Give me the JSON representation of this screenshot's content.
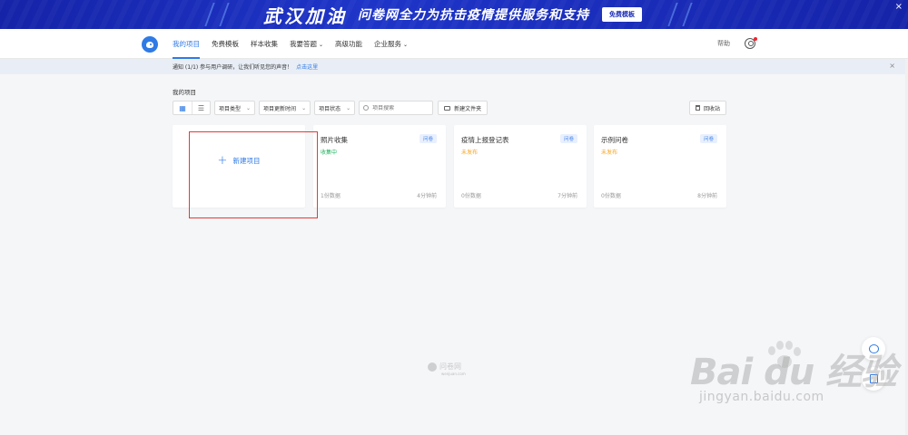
{
  "banner": {
    "slogan_left": "武汉加油",
    "slogan_right": "问卷网全力为抗击疫情提供服务和支持",
    "button_label": "免费模板",
    "close_label": "×"
  },
  "nav": {
    "items": [
      {
        "label": "我的项目",
        "active": true
      },
      {
        "label": "免费模板"
      },
      {
        "label": "样本收集"
      },
      {
        "label": "我要答题",
        "dropdown": true
      },
      {
        "label": "高级功能"
      },
      {
        "label": "企业服务",
        "dropdown": true
      }
    ],
    "help_label": "帮助"
  },
  "notice": {
    "text": "通知  (1/1)  参与用户调研，让我们听见您的声音！",
    "link_label": "点击这里",
    "close_label": "×"
  },
  "projects": {
    "section_title": "我的项目",
    "filters": {
      "type": "项目类型",
      "updated": "项目更新时间",
      "status": "项目状态"
    },
    "search_placeholder": "项目搜索",
    "new_folder_label": "新建文件夹",
    "recycle_label": "回收站",
    "new_project_label": "新建项目",
    "cards": [
      {
        "title": "照片收集",
        "badge": "问卷",
        "status": "收集中",
        "status_color": "#22b35e",
        "count": "1份数据",
        "time": "4分钟前"
      },
      {
        "title": "疫情上报登记表",
        "badge": "问卷",
        "status": "未发布",
        "status_color": "#f5a623",
        "count": "0份数据",
        "time": "7分钟前"
      },
      {
        "title": "示例问卷",
        "badge": "问卷",
        "status": "未发布",
        "status_color": "#f5a623",
        "count": "0份数据",
        "time": "8分钟前"
      }
    ]
  },
  "footer": {
    "brand": "问卷网",
    "sub": "wenjuan.com"
  },
  "watermark": {
    "brand": "Bai du 经验",
    "url": "jingyan.baidu.com"
  },
  "icons": {
    "grid": "grid-view-icon",
    "list": "list-view-icon",
    "search": "search-icon",
    "folder": "folder-plus-icon",
    "bin": "trash-icon",
    "chat": "chat-icon",
    "edit": "edit-icon",
    "user": "user-icon"
  },
  "colors": {
    "accent": "#2f7ae5",
    "banner": "#1a2bb8",
    "highlight_box": "#e53935"
  }
}
